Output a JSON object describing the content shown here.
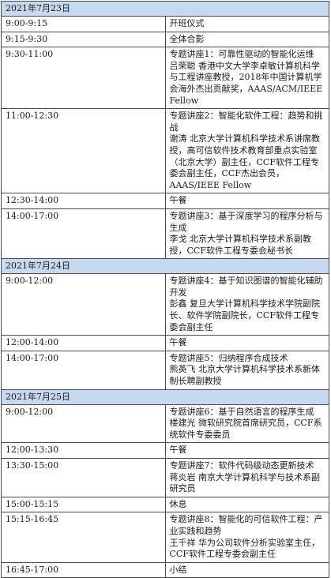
{
  "days": [
    {
      "date": "2021年7月23日",
      "sessions": [
        {
          "time": "9:00-9:15",
          "lines": [
            "开班仪式"
          ]
        },
        {
          "time": "9:15-9:30",
          "lines": [
            "全体合影"
          ]
        },
        {
          "time": "9:30-11:00",
          "lines": [
            "专题讲座1：可靠性驱动的智能化运维",
            "吕荣聪  香港中文大学李卓敏计算机科学与工程讲座教授，2018年中国计算机学会海外杰出贡献奖，AAAS/ACM/IEEE Fellow"
          ]
        },
        {
          "time": "11:00-12:30",
          "lines": [
            "专题讲座2：智能化软件工程：趋势和挑战",
            "谢涛  北京大学计算机科学技术系讲席教授，高可信软件技术教育部重点实验室（北京大学）副主任，CCF软件工程专委会副主任，CCF杰出会员，AAAS/IEEE Fellow"
          ]
        },
        {
          "time": "12:30-14:00",
          "lines": [
            "午餐"
          ]
        },
        {
          "time": "14:00-17:00",
          "lines": [
            "专题讲座3：基于深度学习的程序分析与生成",
            "李戈  北京大学计算机科学技术系副教授，CCF软件工程专委会秘书长"
          ]
        }
      ]
    },
    {
      "date": "2021年7月24日",
      "sessions": [
        {
          "time": "9:00-12:00",
          "lines": [
            "专题讲座4：基于知识图谱的智能化辅助开发",
            "彭鑫  复旦大学计算机科学技术学院副院长、软件学院副院长，CCF软件工程专委会副主任"
          ]
        },
        {
          "time": "12:00-14:00",
          "lines": [
            "午餐"
          ]
        },
        {
          "time": "14:00-17:00",
          "lines": [
            "专题讲座5：归纳程序合成技术",
            "熊英飞  北京大学计算机科学技术系新体制长聘副教授"
          ]
        }
      ]
    },
    {
      "date": "2021年7月25日",
      "sessions": [
        {
          "time": "9:00-12:00",
          "lines": [
            "专题讲座6：基于自然语言的程序生成",
            "楼建光  微软研究院首席研究员，CCF系统软件专委委员"
          ]
        },
        {
          "time": "12:00-13:30",
          "lines": [
            "午餐"
          ]
        },
        {
          "time": "13:30-15:00",
          "lines": [
            "专题讲座7：软件代码级动态更新技术",
            "蒋炎岩  南京大学计算机科学与技术系副研究员"
          ]
        },
        {
          "time": "15:00-15:15",
          "lines": [
            "休息"
          ]
        },
        {
          "time": "15:15-16:45",
          "lines": [
            "专题讲座8：智能化的可信软件工程：产业实践和趋势",
            "王千祥  华为公司软件分析实验室主任，CCF软件工程专委会副主任"
          ]
        },
        {
          "time": "16:45-17:00",
          "lines": [
            "小结"
          ]
        }
      ]
    }
  ]
}
